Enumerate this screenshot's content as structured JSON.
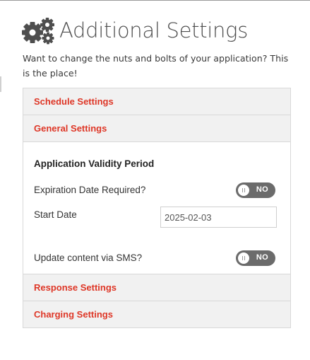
{
  "page": {
    "title": "Additional Settings",
    "description": "Want to change the nuts and bolts of your application? This is the place!"
  },
  "accordion": {
    "schedule_label": "Schedule Settings",
    "general_label": "General Settings",
    "response_label": "Response Settings",
    "charging_label": "Charging Settings"
  },
  "general": {
    "section_title": "Application Validity Period",
    "expiration_label": "Expiration Date Required?",
    "expiration_toggle": "NO",
    "start_date_label": "Start Date",
    "start_date_value": "2025-02-03",
    "sms_label": "Update content via SMS?",
    "sms_toggle": "NO"
  },
  "icons": {
    "header": "gears-icon"
  },
  "colors": {
    "accent": "#de3626",
    "toggle_off": "#6b6b6b",
    "panel_header": "#f1f1f1"
  }
}
